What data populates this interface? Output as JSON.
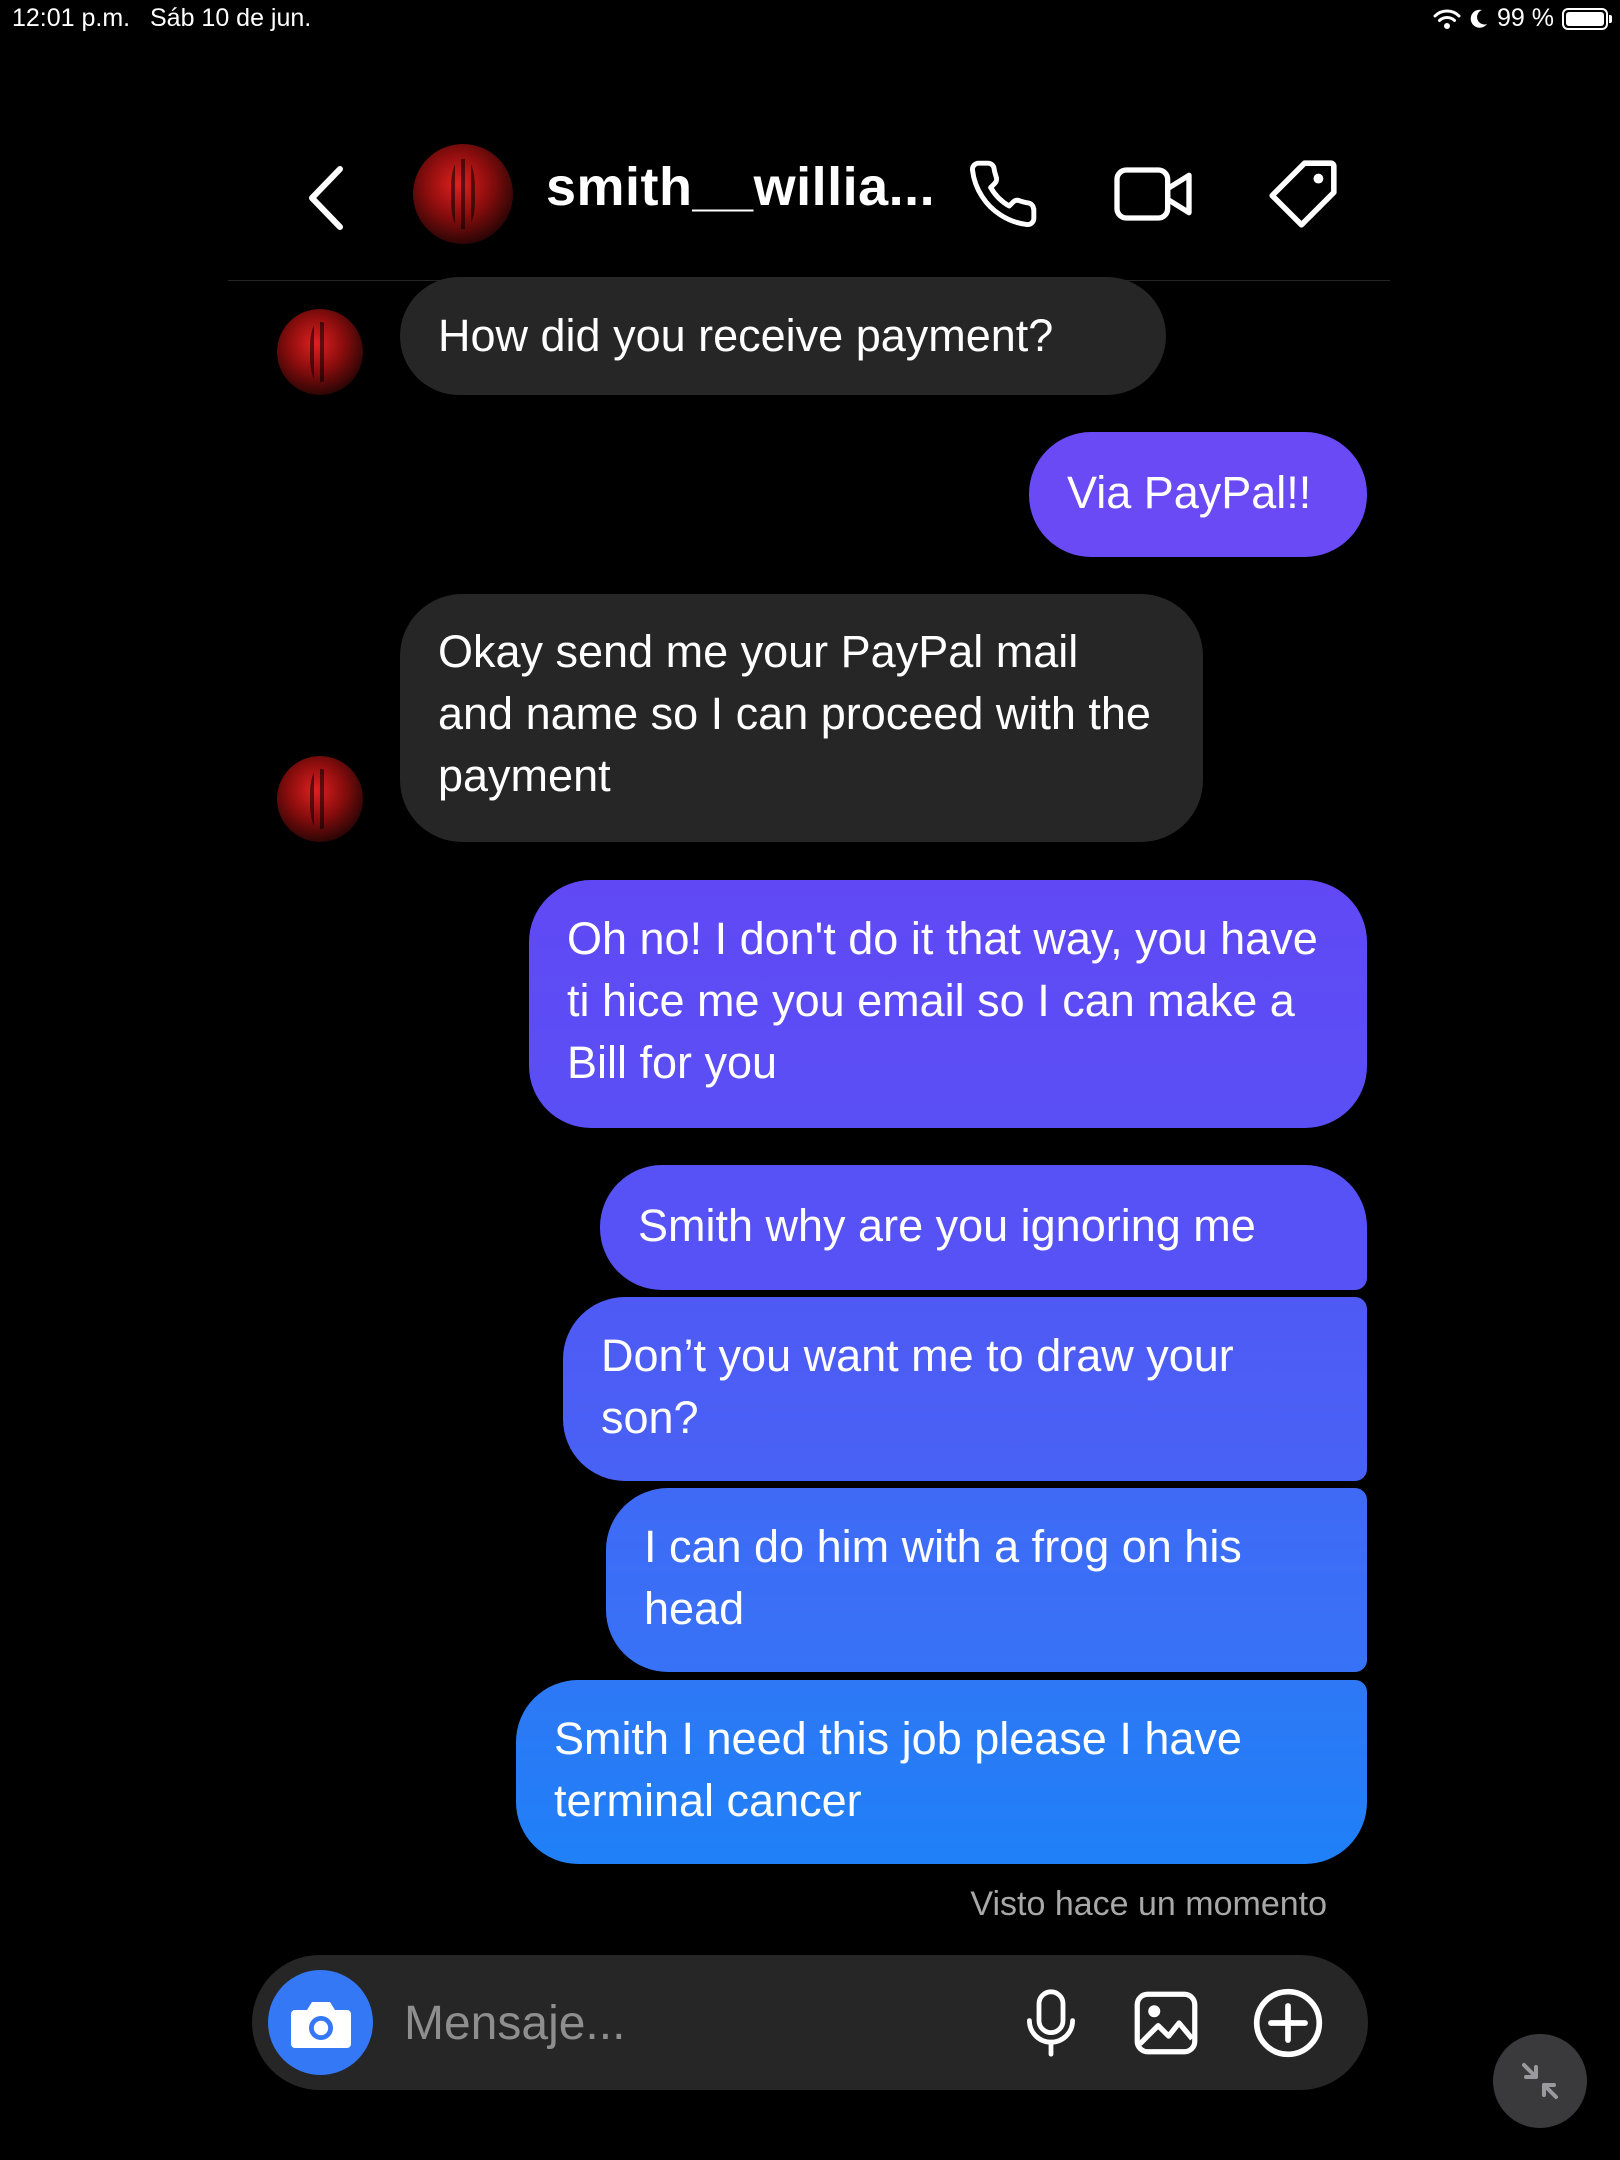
{
  "status_bar": {
    "time": "12:01 p.m.",
    "date": "Sáb 10 de jun.",
    "battery_text": "99 %",
    "battery_level": 0.99
  },
  "header": {
    "username": "smith__willia...",
    "icons": [
      "back-icon",
      "phone-icon",
      "video-icon",
      "tag-icon"
    ]
  },
  "messages": [
    {
      "from": "them",
      "text": "How did you receive payment?"
    },
    {
      "from": "me",
      "text": "Via PayPal!!"
    },
    {
      "from": "them",
      "text": "Okay send me your PayPal mail and name so I can proceed with the payment"
    },
    {
      "from": "me",
      "text": "Oh no! I don't do it that way, you have ti hice me you email so I can make a Bill for you"
    },
    {
      "from": "me",
      "text": "Smith why are you ignoring me"
    },
    {
      "from": "me",
      "text": "Don’t you want me to draw your son?"
    },
    {
      "from": "me",
      "text": "I can do him with a frog on his head"
    },
    {
      "from": "me",
      "text": "Smith I need this job please I have terminal cancer"
    }
  ],
  "seen_text": "Visto hace un momento",
  "composer": {
    "placeholder": "Mensaje...",
    "icons": [
      "camera-icon",
      "microphone-icon",
      "gallery-icon",
      "add-icon"
    ]
  },
  "colors": {
    "background": "#000000",
    "incoming_bubble": "#262626",
    "outgoing_top": "#6a4cf6",
    "outgoing_bottom": "#1e7cf7",
    "camera_button": "#3478f6"
  }
}
